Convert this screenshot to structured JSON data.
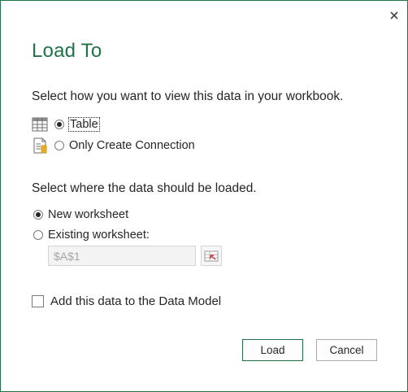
{
  "dialog": {
    "title": "Load To",
    "close_icon": "close-icon"
  },
  "view_section": {
    "prompt": "Select how you want to view this data in your workbook.",
    "options": [
      {
        "label": "Table",
        "icon": "table-icon",
        "selected": true
      },
      {
        "label": "Only Create Connection",
        "icon": "connection-icon",
        "selected": false
      }
    ]
  },
  "location_section": {
    "prompt": "Select where the data should be loaded.",
    "options": [
      {
        "label": "New worksheet",
        "selected": true
      },
      {
        "label": "Existing worksheet:",
        "selected": false
      }
    ],
    "cell_reference": {
      "value": "$A$1",
      "enabled": false
    },
    "range_picker_icon": "range-select-icon"
  },
  "data_model": {
    "label": "Add this data to the Data Model",
    "checked": false
  },
  "buttons": {
    "load_label": "Load",
    "cancel_label": "Cancel"
  },
  "colors": {
    "accent": "#217346",
    "text": "#262626",
    "disabled_text": "#a6a6a6"
  }
}
